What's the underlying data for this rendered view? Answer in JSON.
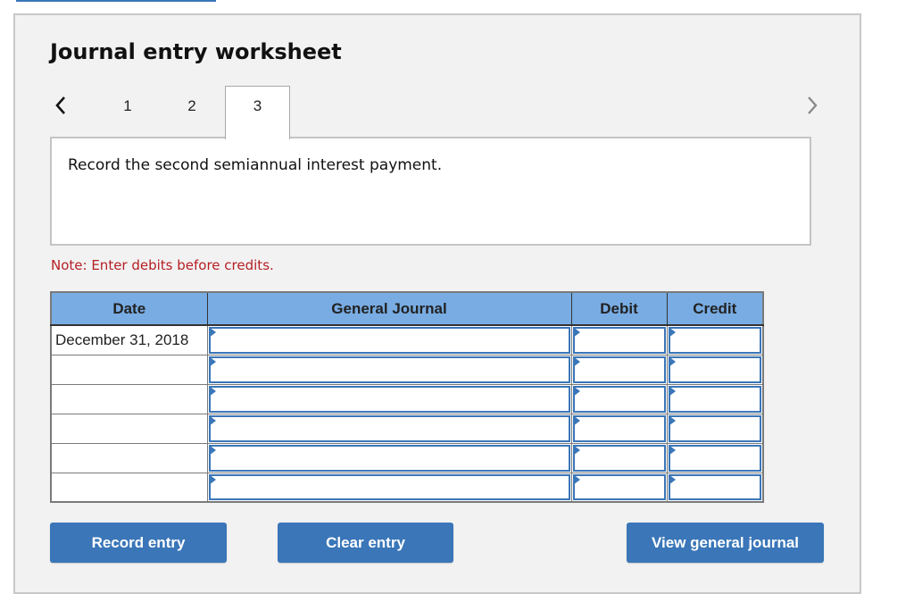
{
  "header": {
    "title": "Journal entry worksheet"
  },
  "navigation": {
    "prev_icon": "chevron-left-icon",
    "next_icon": "chevron-right-icon",
    "tabs": [
      {
        "label": "1",
        "active": false
      },
      {
        "label": "2",
        "active": false
      },
      {
        "label": "3",
        "active": true
      }
    ]
  },
  "instruction": {
    "text": "Record the second semiannual interest payment."
  },
  "note": {
    "text": "Note: Enter debits before credits.",
    "color": "#b51f24"
  },
  "journal_table": {
    "columns": [
      "Date",
      "General Journal",
      "Debit",
      "Credit"
    ],
    "rows": [
      {
        "date": "December 31, 2018",
        "account": "",
        "debit": "",
        "credit": ""
      },
      {
        "date": "",
        "account": "",
        "debit": "",
        "credit": ""
      },
      {
        "date": "",
        "account": "",
        "debit": "",
        "credit": ""
      },
      {
        "date": "",
        "account": "",
        "debit": "",
        "credit": ""
      },
      {
        "date": "",
        "account": "",
        "debit": "",
        "credit": ""
      },
      {
        "date": "",
        "account": "",
        "debit": "",
        "credit": ""
      }
    ]
  },
  "buttons": {
    "record_entry": "Record entry",
    "clear_entry": "Clear entry",
    "view_general_journal": "View general journal"
  },
  "colors": {
    "accent": "#3a76b8",
    "header_fill": "#78ace3",
    "panel_bg": "#f2f2f2"
  }
}
